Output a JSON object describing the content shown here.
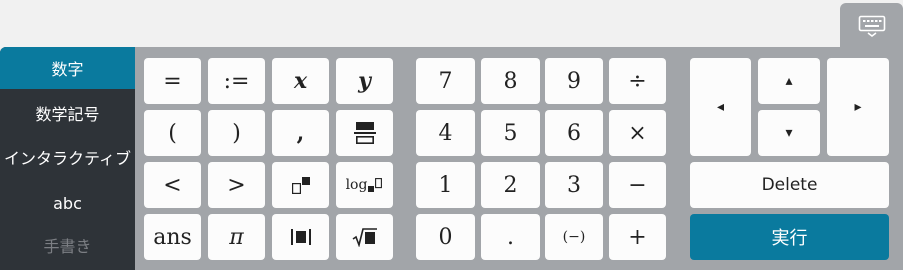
{
  "sidebar": {
    "items": [
      {
        "label": "数字",
        "state": "active"
      },
      {
        "label": "数学記号",
        "state": "normal"
      },
      {
        "label": "インタラクティブ",
        "state": "normal"
      },
      {
        "label": "abc",
        "state": "normal"
      },
      {
        "label": "手書き",
        "state": "disabled"
      }
    ]
  },
  "toggle": {
    "icon": "keyboard-icon"
  },
  "symbols": {
    "equals": "=",
    "assign": ":=",
    "var_x": "x",
    "var_y": "y",
    "fraction_icon": "fraction-icon",
    "open_paren": "(",
    "close_paren": ")",
    "comma": ",",
    "less_than": "<",
    "greater_than": ">",
    "power_icon": "power-icon",
    "log_prefix": "log",
    "ans": "ans",
    "pi": "π",
    "abs_icon": "absolute-value-icon",
    "sqrt_icon": "square-root-icon"
  },
  "numbers": {
    "seven": "7",
    "eight": "8",
    "nine": "9",
    "divide": "÷",
    "four": "4",
    "five": "5",
    "six": "6",
    "times": "×",
    "one": "1",
    "two": "2",
    "three": "3",
    "minus": "−",
    "zero": "0",
    "decimal": ".",
    "negate": "(−)",
    "plus": "+"
  },
  "navigation": {
    "left": "◂",
    "up": "▴",
    "down": "▾",
    "right": "▸",
    "delete": "Delete",
    "execute": "実行"
  },
  "colors": {
    "active": "#0a7a9e",
    "sidebar": "#2e3338",
    "panel": "#a2a5a9",
    "key": "#fcfcfc"
  }
}
